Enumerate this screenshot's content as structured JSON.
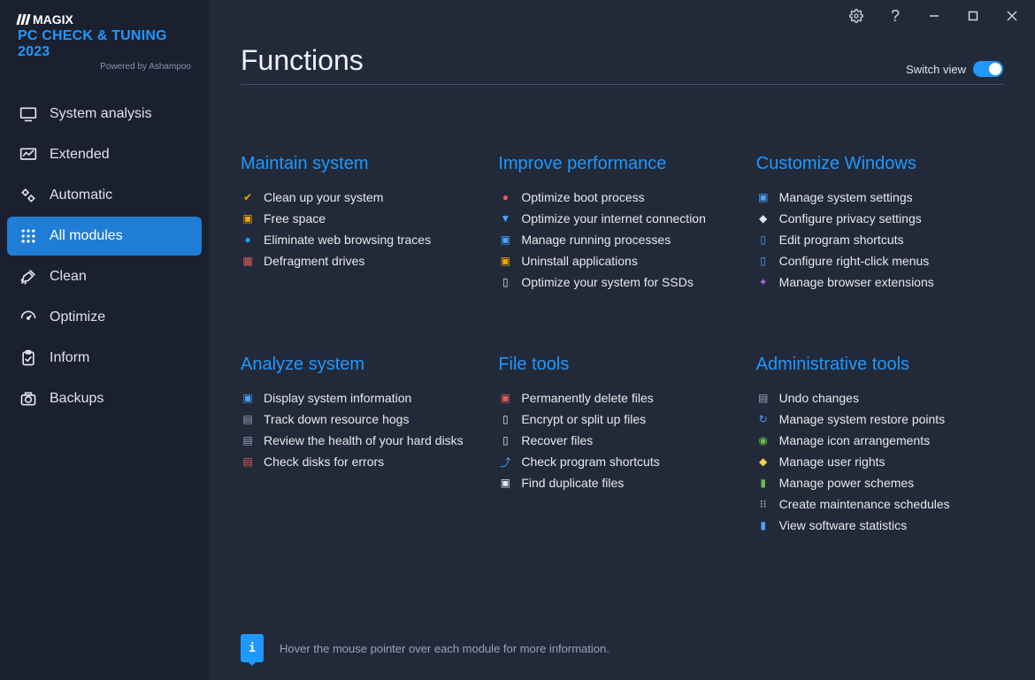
{
  "branding": {
    "company": "MAGIX",
    "product": "PC CHECK & TUNING 2023",
    "powered_by": "Powered by Ashampoo"
  },
  "sidebar": {
    "items": [
      {
        "key": "system-analysis",
        "label": "System analysis",
        "icon": "monitor-icon"
      },
      {
        "key": "extended",
        "label": "Extended",
        "icon": "chart-icon"
      },
      {
        "key": "automatic",
        "label": "Automatic",
        "icon": "gears-icon"
      },
      {
        "key": "all-modules",
        "label": "All modules",
        "icon": "grid-icon",
        "active": true
      },
      {
        "key": "clean",
        "label": "Clean",
        "icon": "broom-icon"
      },
      {
        "key": "optimize",
        "label": "Optimize",
        "icon": "gauge-icon"
      },
      {
        "key": "inform",
        "label": "Inform",
        "icon": "clipboard-icon"
      },
      {
        "key": "backups",
        "label": "Backups",
        "icon": "camera-icon"
      }
    ]
  },
  "header": {
    "title": "Functions",
    "switch_label": "Switch view",
    "switch_on": true
  },
  "groups": [
    {
      "title": "Maintain system",
      "items": [
        {
          "label": "Clean up your system",
          "icon": "✔",
          "iconColor": "#f2a500"
        },
        {
          "label": "Free space",
          "icon": "▣",
          "iconColor": "#f2a500"
        },
        {
          "label": "Eliminate web browsing traces",
          "icon": "●",
          "iconColor": "#1f98ff"
        },
        {
          "label": "Defragment drives",
          "icon": "▦",
          "iconColor": "#e05b5b"
        }
      ]
    },
    {
      "title": "Improve performance",
      "items": [
        {
          "label": "Optimize boot process",
          "icon": "●",
          "iconColor": "#e05b5b"
        },
        {
          "label": "Optimize your internet connection",
          "icon": "▼",
          "iconColor": "#4aa3ff"
        },
        {
          "label": "Manage running processes",
          "icon": "▣",
          "iconColor": "#4aa3ff"
        },
        {
          "label": "Uninstall applications",
          "icon": "▣",
          "iconColor": "#f2a500"
        },
        {
          "label": "Optimize your system for SSDs",
          "icon": "▯",
          "iconColor": "#dfe3ea"
        }
      ]
    },
    {
      "title": "Customize Windows",
      "items": [
        {
          "label": "Manage system settings",
          "icon": "▣",
          "iconColor": "#4aa3ff"
        },
        {
          "label": "Configure privacy settings",
          "icon": "◆",
          "iconColor": "#dfe3ea"
        },
        {
          "label": "Edit program shortcuts",
          "icon": "▯",
          "iconColor": "#4aa3ff"
        },
        {
          "label": "Configure right-click menus",
          "icon": "▯",
          "iconColor": "#4aa3ff"
        },
        {
          "label": "Manage browser extensions",
          "icon": "✦",
          "iconColor": "#b060e0"
        }
      ]
    },
    {
      "title": "Analyze system",
      "items": [
        {
          "label": "Display system information",
          "icon": "▣",
          "iconColor": "#4aa3ff"
        },
        {
          "label": "Track down resource hogs",
          "icon": "▤",
          "iconColor": "#9aa3b5"
        },
        {
          "label": "Review the health of your hard disks",
          "icon": "▤",
          "iconColor": "#9aa3b5"
        },
        {
          "label": "Check disks for errors",
          "icon": "▤",
          "iconColor": "#e05b5b"
        }
      ]
    },
    {
      "title": "File tools",
      "items": [
        {
          "label": "Permanently delete files",
          "icon": "▣",
          "iconColor": "#e05b5b"
        },
        {
          "label": "Encrypt or split up files",
          "icon": "▯",
          "iconColor": "#dfe3ea"
        },
        {
          "label": "Recover files",
          "icon": "▯",
          "iconColor": "#dfe3ea"
        },
        {
          "label": "Check program shortcuts",
          "icon": "⤴",
          "iconColor": "#4aa3ff"
        },
        {
          "label": "Find duplicate files",
          "icon": "▣",
          "iconColor": "#dfe3ea"
        }
      ]
    },
    {
      "title": "Administrative tools",
      "items": [
        {
          "label": "Undo changes",
          "icon": "▤",
          "iconColor": "#9aa3b5"
        },
        {
          "label": "Manage system restore points",
          "icon": "↻",
          "iconColor": "#4aa3ff"
        },
        {
          "label": "Manage icon arrangements",
          "icon": "◉",
          "iconColor": "#6bbf4b"
        },
        {
          "label": "Manage user rights",
          "icon": "◆",
          "iconColor": "#f2d24b"
        },
        {
          "label": "Manage power schemes",
          "icon": "▮",
          "iconColor": "#6bbf4b"
        },
        {
          "label": "Create maintenance schedules",
          "icon": "⁝⁝",
          "iconColor": "#dfe3ea"
        },
        {
          "label": "View software statistics",
          "icon": "▮",
          "iconColor": "#4aa3ff"
        }
      ]
    }
  ],
  "footer": {
    "hint": "Hover the mouse pointer over each module for more information."
  },
  "titlebar": {
    "settings": "settings",
    "help": "help",
    "minimize": "minimize",
    "maximize": "maximize",
    "close": "close"
  }
}
